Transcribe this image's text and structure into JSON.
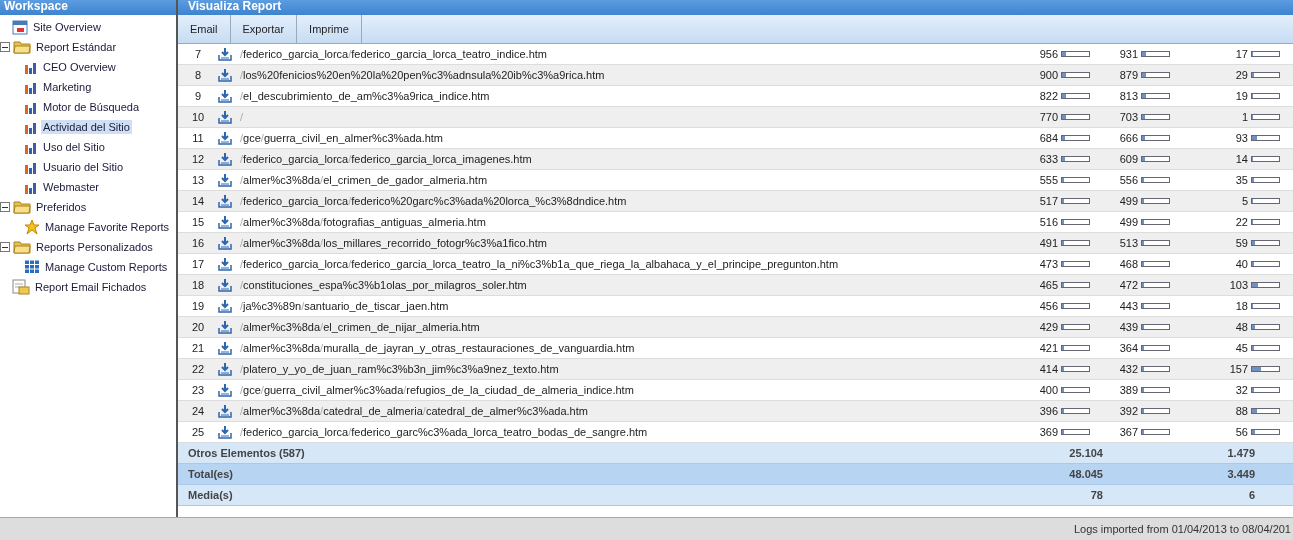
{
  "sidebar": {
    "title": "Workspace",
    "items": [
      {
        "label": "Site Overview",
        "kind": "calendar",
        "selected": false
      },
      {
        "label": "Report Estándar",
        "kind": "folder",
        "selected": false,
        "expanded": true,
        "children": [
          {
            "label": "CEO Overview",
            "kind": "chart",
            "selected": false
          },
          {
            "label": "Marketing",
            "kind": "chart",
            "selected": false
          },
          {
            "label": "Motor de Búsqueda",
            "kind": "chart",
            "selected": false
          },
          {
            "label": "Actividad del Sitio",
            "kind": "chart",
            "selected": true
          },
          {
            "label": "Uso del Sitio",
            "kind": "chart",
            "selected": false
          },
          {
            "label": "Usuario del Sitio",
            "kind": "chart",
            "selected": false
          },
          {
            "label": "Webmaster",
            "kind": "chart",
            "selected": false
          }
        ]
      },
      {
        "label": "Preferidos",
        "kind": "folder",
        "selected": false,
        "expanded": true,
        "children": [
          {
            "label": "Manage Favorite Reports",
            "kind": "star",
            "selected": false
          }
        ]
      },
      {
        "label": "Reports Personalizados",
        "kind": "folder",
        "selected": false,
        "expanded": true,
        "children": [
          {
            "label": "Manage Custom Reports",
            "kind": "grid",
            "selected": false
          }
        ]
      },
      {
        "label": "Report Email Fichados",
        "kind": "report",
        "selected": false
      }
    ]
  },
  "report": {
    "title": "Visualiza Report",
    "toolbar": [
      "Email",
      "Exportar",
      "Imprime"
    ],
    "rows": [
      {
        "rank": "7",
        "path": "/federico_garcia_lorca/federico_garcia_lorca_teatro_indice.htm",
        "values": [
          {
            "value": "956",
            "level": 0.16
          },
          {
            "value": "931",
            "level": 0.15
          },
          {
            "value": "17",
            "level": 0.04
          }
        ]
      },
      {
        "rank": "8",
        "path": "/los%20fenicios%20en%20la%20pen%c3%adnsula%20ib%c3%a9rica.htm",
        "values": [
          {
            "value": "900",
            "level": 0.15
          },
          {
            "value": "879",
            "level": 0.14
          },
          {
            "value": "29",
            "level": 0.06
          }
        ]
      },
      {
        "rank": "9",
        "path": "/el_descubrimiento_de_am%c3%a9rica_indice.htm",
        "values": [
          {
            "value": "822",
            "level": 0.14
          },
          {
            "value": "813",
            "level": 0.13
          },
          {
            "value": "19",
            "level": 0.04
          }
        ]
      },
      {
        "rank": "10",
        "path": "/",
        "values": [
          {
            "value": "770",
            "level": 0.13
          },
          {
            "value": "703",
            "level": 0.12
          },
          {
            "value": "1",
            "level": 0.02
          }
        ]
      },
      {
        "rank": "11",
        "path": "/gce/guerra_civil_en_almer%c3%ada.htm",
        "values": [
          {
            "value": "684",
            "level": 0.11
          },
          {
            "value": "666",
            "level": 0.11
          },
          {
            "value": "93",
            "level": 0.2
          }
        ]
      },
      {
        "rank": "12",
        "path": "/federico_garcia_lorca/federico_garcia_lorca_imagenes.htm",
        "values": [
          {
            "value": "633",
            "level": 0.1
          },
          {
            "value": "609",
            "level": 0.1
          },
          {
            "value": "14",
            "level": 0.03
          }
        ]
      },
      {
        "rank": "13",
        "path": "/almer%c3%8da/el_crimen_de_gador_almeria.htm",
        "values": [
          {
            "value": "555",
            "level": 0.09
          },
          {
            "value": "556",
            "level": 0.09
          },
          {
            "value": "35",
            "level": 0.07
          }
        ]
      },
      {
        "rank": "14",
        "path": "/federico_garcia_lorca/federico%20garc%c3%ada%20lorca_%c3%8dndice.htm",
        "values": [
          {
            "value": "517",
            "level": 0.08
          },
          {
            "value": "499",
            "level": 0.08
          },
          {
            "value": "5",
            "level": 0.01
          }
        ]
      },
      {
        "rank": "15",
        "path": "/almer%c3%8da/fotografias_antiguas_almeria.htm",
        "values": [
          {
            "value": "516",
            "level": 0.08
          },
          {
            "value": "499",
            "level": 0.08
          },
          {
            "value": "22",
            "level": 0.05
          }
        ]
      },
      {
        "rank": "16",
        "path": "/almer%c3%8da/los_millares_recorrido_fotogr%c3%a1fico.htm",
        "values": [
          {
            "value": "491",
            "level": 0.08
          },
          {
            "value": "513",
            "level": 0.08
          },
          {
            "value": "59",
            "level": 0.12
          }
        ]
      },
      {
        "rank": "17",
        "path": "/federico_garcia_lorca/federico_garcia_lorca_teatro_la_ni%c3%b1a_que_riega_la_albahaca_y_el_principe_pregunton.htm",
        "values": [
          {
            "value": "473",
            "level": 0.08
          },
          {
            "value": "468",
            "level": 0.08
          },
          {
            "value": "40",
            "level": 0.08
          }
        ]
      },
      {
        "rank": "18",
        "path": "/constituciones_espa%c3%b1olas_por_milagros_soler.htm",
        "values": [
          {
            "value": "465",
            "level": 0.08
          },
          {
            "value": "472",
            "level": 0.08
          },
          {
            "value": "103",
            "level": 0.22
          }
        ]
      },
      {
        "rank": "19",
        "path": "/ja%c3%89n/santuario_de_tiscar_jaen.htm",
        "values": [
          {
            "value": "456",
            "level": 0.07
          },
          {
            "value": "443",
            "level": 0.07
          },
          {
            "value": "18",
            "level": 0.04
          }
        ]
      },
      {
        "rank": "20",
        "path": "/almer%c3%8da/el_crimen_de_nijar_almeria.htm",
        "values": [
          {
            "value": "429",
            "level": 0.07
          },
          {
            "value": "439",
            "level": 0.07
          },
          {
            "value": "48",
            "level": 0.1
          }
        ]
      },
      {
        "rank": "21",
        "path": "/almer%c3%8da/muralla_de_jayran_y_otras_restauraciones_de_vanguardia.htm",
        "values": [
          {
            "value": "421",
            "level": 0.07
          },
          {
            "value": "364",
            "level": 0.06
          },
          {
            "value": "45",
            "level": 0.09
          }
        ]
      },
      {
        "rank": "22",
        "path": "/platero_y_yo_de_juan_ram%c3%b3n_jim%c3%a9nez_texto.htm",
        "values": [
          {
            "value": "414",
            "level": 0.07
          },
          {
            "value": "432",
            "level": 0.07
          },
          {
            "value": "157",
            "level": 0.33
          }
        ]
      },
      {
        "rank": "23",
        "path": "/gce/guerra_civil_almer%c3%ada/refugios_de_la_ciudad_de_almeria_indice.htm",
        "values": [
          {
            "value": "400",
            "level": 0.06
          },
          {
            "value": "389",
            "level": 0.06
          },
          {
            "value": "32",
            "level": 0.07
          }
        ]
      },
      {
        "rank": "24",
        "path": "/almer%c3%8da/catedral_de_almeria/catedral_de_almer%c3%ada.htm",
        "values": [
          {
            "value": "396",
            "level": 0.06
          },
          {
            "value": "392",
            "level": 0.06
          },
          {
            "value": "88",
            "level": 0.18
          }
        ]
      },
      {
        "rank": "25",
        "path": "/federico_garcia_lorca/federico_garc%c3%ada_lorca_teatro_bodas_de_sangre.htm",
        "values": [
          {
            "value": "369",
            "level": 0.06
          },
          {
            "value": "367",
            "level": 0.06
          },
          {
            "value": "56",
            "level": 0.12
          }
        ]
      }
    ],
    "summary": [
      {
        "label": "Otros Elementos (587)",
        "kind": "other",
        "column_1": "25.104",
        "column_3": "1.479"
      },
      {
        "label": "Total(es)",
        "kind": "total",
        "column_1": "48.045",
        "column_3": "3.449"
      },
      {
        "label": "Media(s)",
        "kind": "other",
        "column_1": "78",
        "column_3": "6"
      }
    ]
  },
  "status_bar": "Logs imported from 01/04/2013 to 08/04/201"
}
